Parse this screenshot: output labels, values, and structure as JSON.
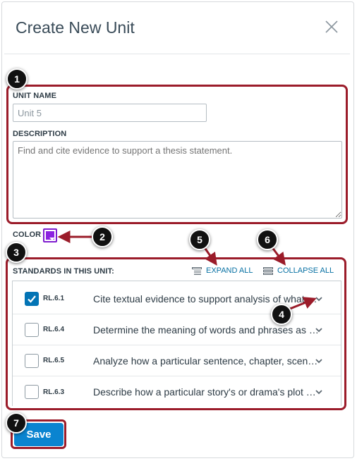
{
  "dialog": {
    "title": "Create New Unit",
    "close_icon": "close-icon"
  },
  "form": {
    "unit_name_label": "UNIT NAME",
    "unit_name_value": "Unit 5",
    "description_label": "DESCRIPTION",
    "description_placeholder": "Find and cite evidence to support a thesis statement.",
    "color_label": "COLOR",
    "color_value": "#8b22e0"
  },
  "standards": {
    "header": "STANDARDS IN THIS UNIT:",
    "expand_all": "EXPAND ALL",
    "collapse_all": "COLLAPSE ALL",
    "items": [
      {
        "code": "RL.6.1",
        "description": "Cite textual evidence to support analysis of what the text says explicitly",
        "checked": true
      },
      {
        "code": "RL.6.4",
        "description": "Determine the meaning of words and phrases as they are used in a text",
        "checked": false
      },
      {
        "code": "RL.6.5",
        "description": "Analyze how a particular sentence, chapter, scene, or stanza fits into the overall structure",
        "checked": false
      },
      {
        "code": "RL.6.3",
        "description": "Describe how a particular story's or drama's plot unfolds in a series of episodes",
        "checked": false
      }
    ]
  },
  "actions": {
    "save_label": "Save"
  },
  "annotations": {
    "badges": [
      "1",
      "2",
      "3",
      "4",
      "5",
      "6",
      "7"
    ],
    "highlight_color": "#9b1c2a"
  }
}
